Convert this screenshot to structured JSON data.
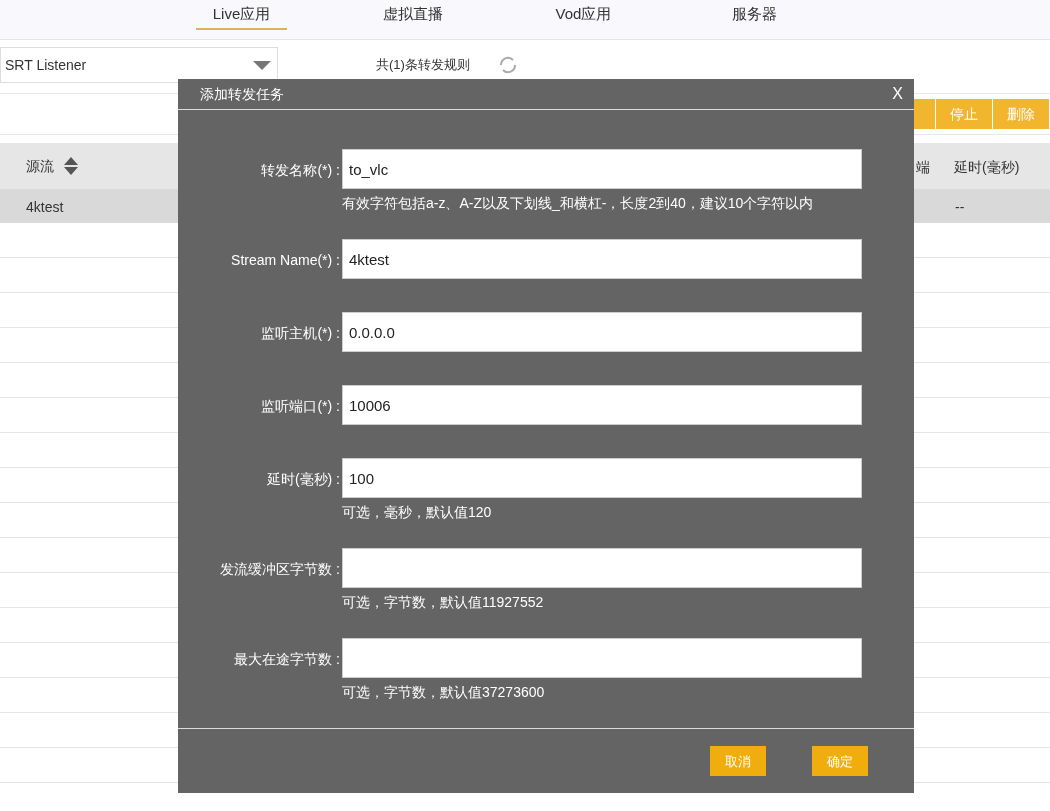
{
  "nav": {
    "tabs": [
      {
        "label": "Live应用",
        "selected": true
      },
      {
        "label": "虚拟直播",
        "selected": false
      },
      {
        "label": "Vod应用",
        "selected": false
      },
      {
        "label": "服务器",
        "selected": false
      }
    ]
  },
  "filter": {
    "protocol": "SRT Listener",
    "summary": "共(1)条转发规则"
  },
  "toolbar": {
    "buttons": [
      "停止",
      "删除"
    ]
  },
  "table": {
    "columns": [
      {
        "label": "源流",
        "sortable": true
      },
      {
        "label": "端",
        "sortable": false
      },
      {
        "label": "延时(毫秒)",
        "sortable": false
      }
    ],
    "rows": [
      {
        "source": "4ktest",
        "delay": "--"
      }
    ]
  },
  "dialog": {
    "title": "添加转发任务",
    "close": "X",
    "fields": [
      {
        "label": "转发名称(*) :",
        "value": "to_vlc",
        "hint": "有效字符包括a-z、A-Z以及下划线_和横杠-，长度2到40，建议10个字符以内"
      },
      {
        "label": "Stream Name(*) :",
        "value": "4ktest"
      },
      {
        "label": "监听主机(*) :",
        "value": "0.0.0.0"
      },
      {
        "label": "监听端口(*) :",
        "value": "10006"
      },
      {
        "label": "延时(毫秒) :",
        "value": "100",
        "hint": "可选，毫秒，默认值120"
      },
      {
        "label": "发流缓冲区字节数 :",
        "hint": "可选，字节数，默认值11927552"
      },
      {
        "label": "最大在途字节数 :",
        "hint": "可选，字节数，默认值37273600"
      }
    ],
    "buttons": [
      "取消",
      "确定"
    ]
  }
}
